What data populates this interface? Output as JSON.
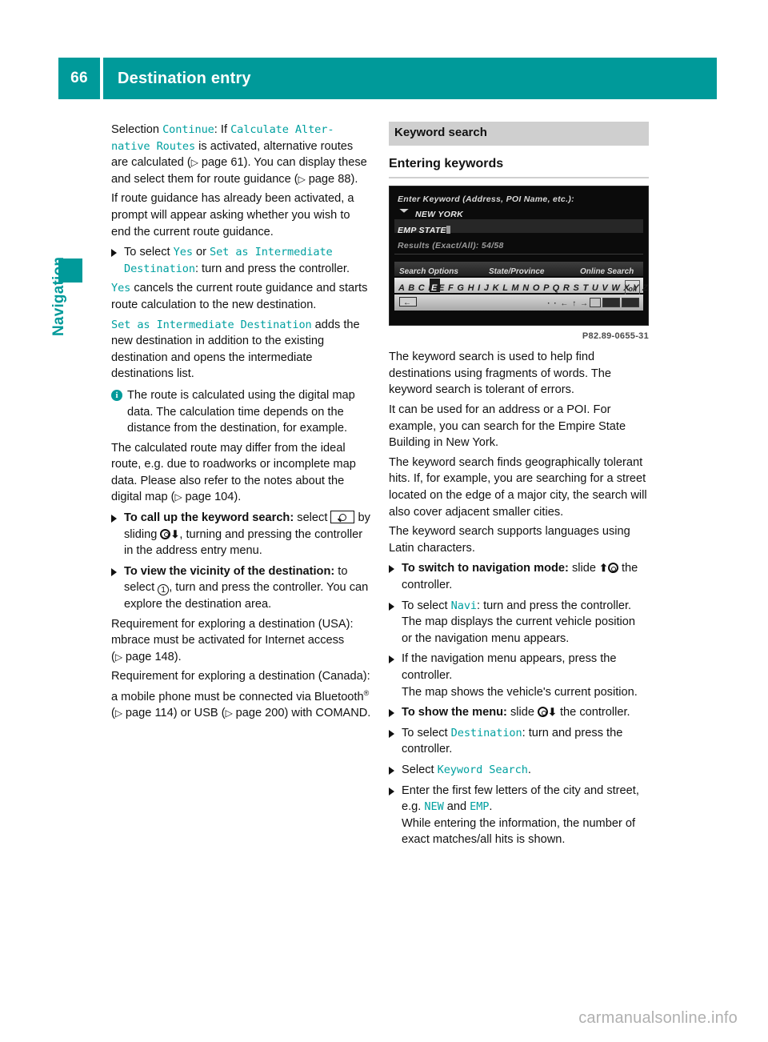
{
  "header": {
    "page_number": "66",
    "title": "Destination entry"
  },
  "sidebar": {
    "chapter_label": "Navigation"
  },
  "footer": {
    "watermark": "carmanualsonline.info"
  },
  "left_column": {
    "p1": {
      "a": "Selection ",
      "code1": "Continue",
      "b": ": If ",
      "code2": "Calculate Alter-native Routes",
      "c": " is activated, alternative routes are calculated (",
      "ref1": "page 61",
      "d": "). You can display these and select them for route guidance (",
      "ref2": "page 88",
      "e": ")."
    },
    "p2": "If route guidance has already been activated, a prompt will appear asking whether you wish to end the current route guidance.",
    "b1": {
      "a": "To select ",
      "code1": "Yes",
      "b": " or ",
      "code2": "Set as Intermediate Destination",
      "c": ": turn and press the controller."
    },
    "p3": {
      "code": "Yes",
      "text": " cancels the current route guidance and starts route calculation to the new destination."
    },
    "p4": {
      "code": "Set as Intermediate Destination",
      "text": " adds the new destination in addition to the existing destination and opens the intermediate destinations list."
    },
    "note": "The route is calculated using the digital map data. The calculation time depends on the distance from the destination, for example.",
    "p5": {
      "a": "The calculated route may differ from the ideal route, e.g. due to roadworks or incomplete map data. Please also refer to the notes about the digital map (",
      "ref": "page 104",
      "b": ")."
    },
    "b2": {
      "bold": "To call up the keyword search:",
      "a": " select ",
      "b": " by sliding ",
      "c": ", turning and pressing the controller in the address entry menu."
    },
    "b3": {
      "bold": "To view the vicinity of the destination:",
      "a": " to select ",
      "b": ", turn and press the controller. You can explore the destination area."
    },
    "p6": {
      "a": "Requirement for exploring a destination (USA): mbrace must be activated for Internet access (",
      "ref": "page 148",
      "b": ")."
    },
    "p7": {
      "a": "Requirement for exploring a destination (Canada): a mobile phone must be connected via Bluetooth",
      "sup": "®",
      "b": " (",
      "ref1": "page 114",
      "c": ") or USB (",
      "ref2": "page 200",
      "d": ") with COMAND."
    }
  },
  "right_column": {
    "section_heading": "Keyword search",
    "sub_heading": "Entering keywords",
    "device_screenshot": {
      "prompt": "Enter Keyword (Address, POI Name, etc.):",
      "city_entry": "NEW YORK",
      "street_entry": "EMP STATE",
      "results": "Results (Exact/All): 54/58",
      "menu": [
        "Search Options",
        "State/Province",
        "Online Search"
      ],
      "alphabet": "A B C D E F G H I J K L M N O P Q R S T U V W X Y Z",
      "highlighted_letter": "E",
      "ok_key": "ok",
      "caption": "P82.89-0655-31"
    },
    "p1": "The keyword search is used to help find destinations using fragments of words. The keyword search is tolerant of errors.",
    "p2": "It can be used for an address or a POI. For example, you can search for the Empire State Building in New York.",
    "p3": "The keyword search finds geographically tolerant hits. If, for example, you are searching for a street located on the edge of a major city, the search will also cover adjacent smaller cities.",
    "p4": "The keyword search supports languages using Latin characters.",
    "b1": {
      "bold": "To switch to navigation mode:",
      "a": " slide ",
      "b": " the controller."
    },
    "b2": {
      "a": "To select ",
      "code": "Navi",
      "b": ": turn and press the controller.",
      "cont": "The map displays the current vehicle position or the navigation menu appears."
    },
    "b3": {
      "a": "If the navigation menu appears, press the controller.",
      "cont": "The map shows the vehicle's current position."
    },
    "b4": {
      "bold": "To show the menu:",
      "a": " slide ",
      "b": " the controller."
    },
    "b5": {
      "a": "To select ",
      "code": "Destination",
      "b": ": turn and press the controller."
    },
    "b6": {
      "a": "Select ",
      "code": "Keyword Search",
      "b": "."
    },
    "b7": {
      "a": "Enter the first few letters of the city and street, e.g. ",
      "code1": "NEW",
      "b": " and ",
      "code2": "EMP",
      "c": ".",
      "cont": "While entering the information, the number of exact matches/all hits is shown."
    }
  }
}
